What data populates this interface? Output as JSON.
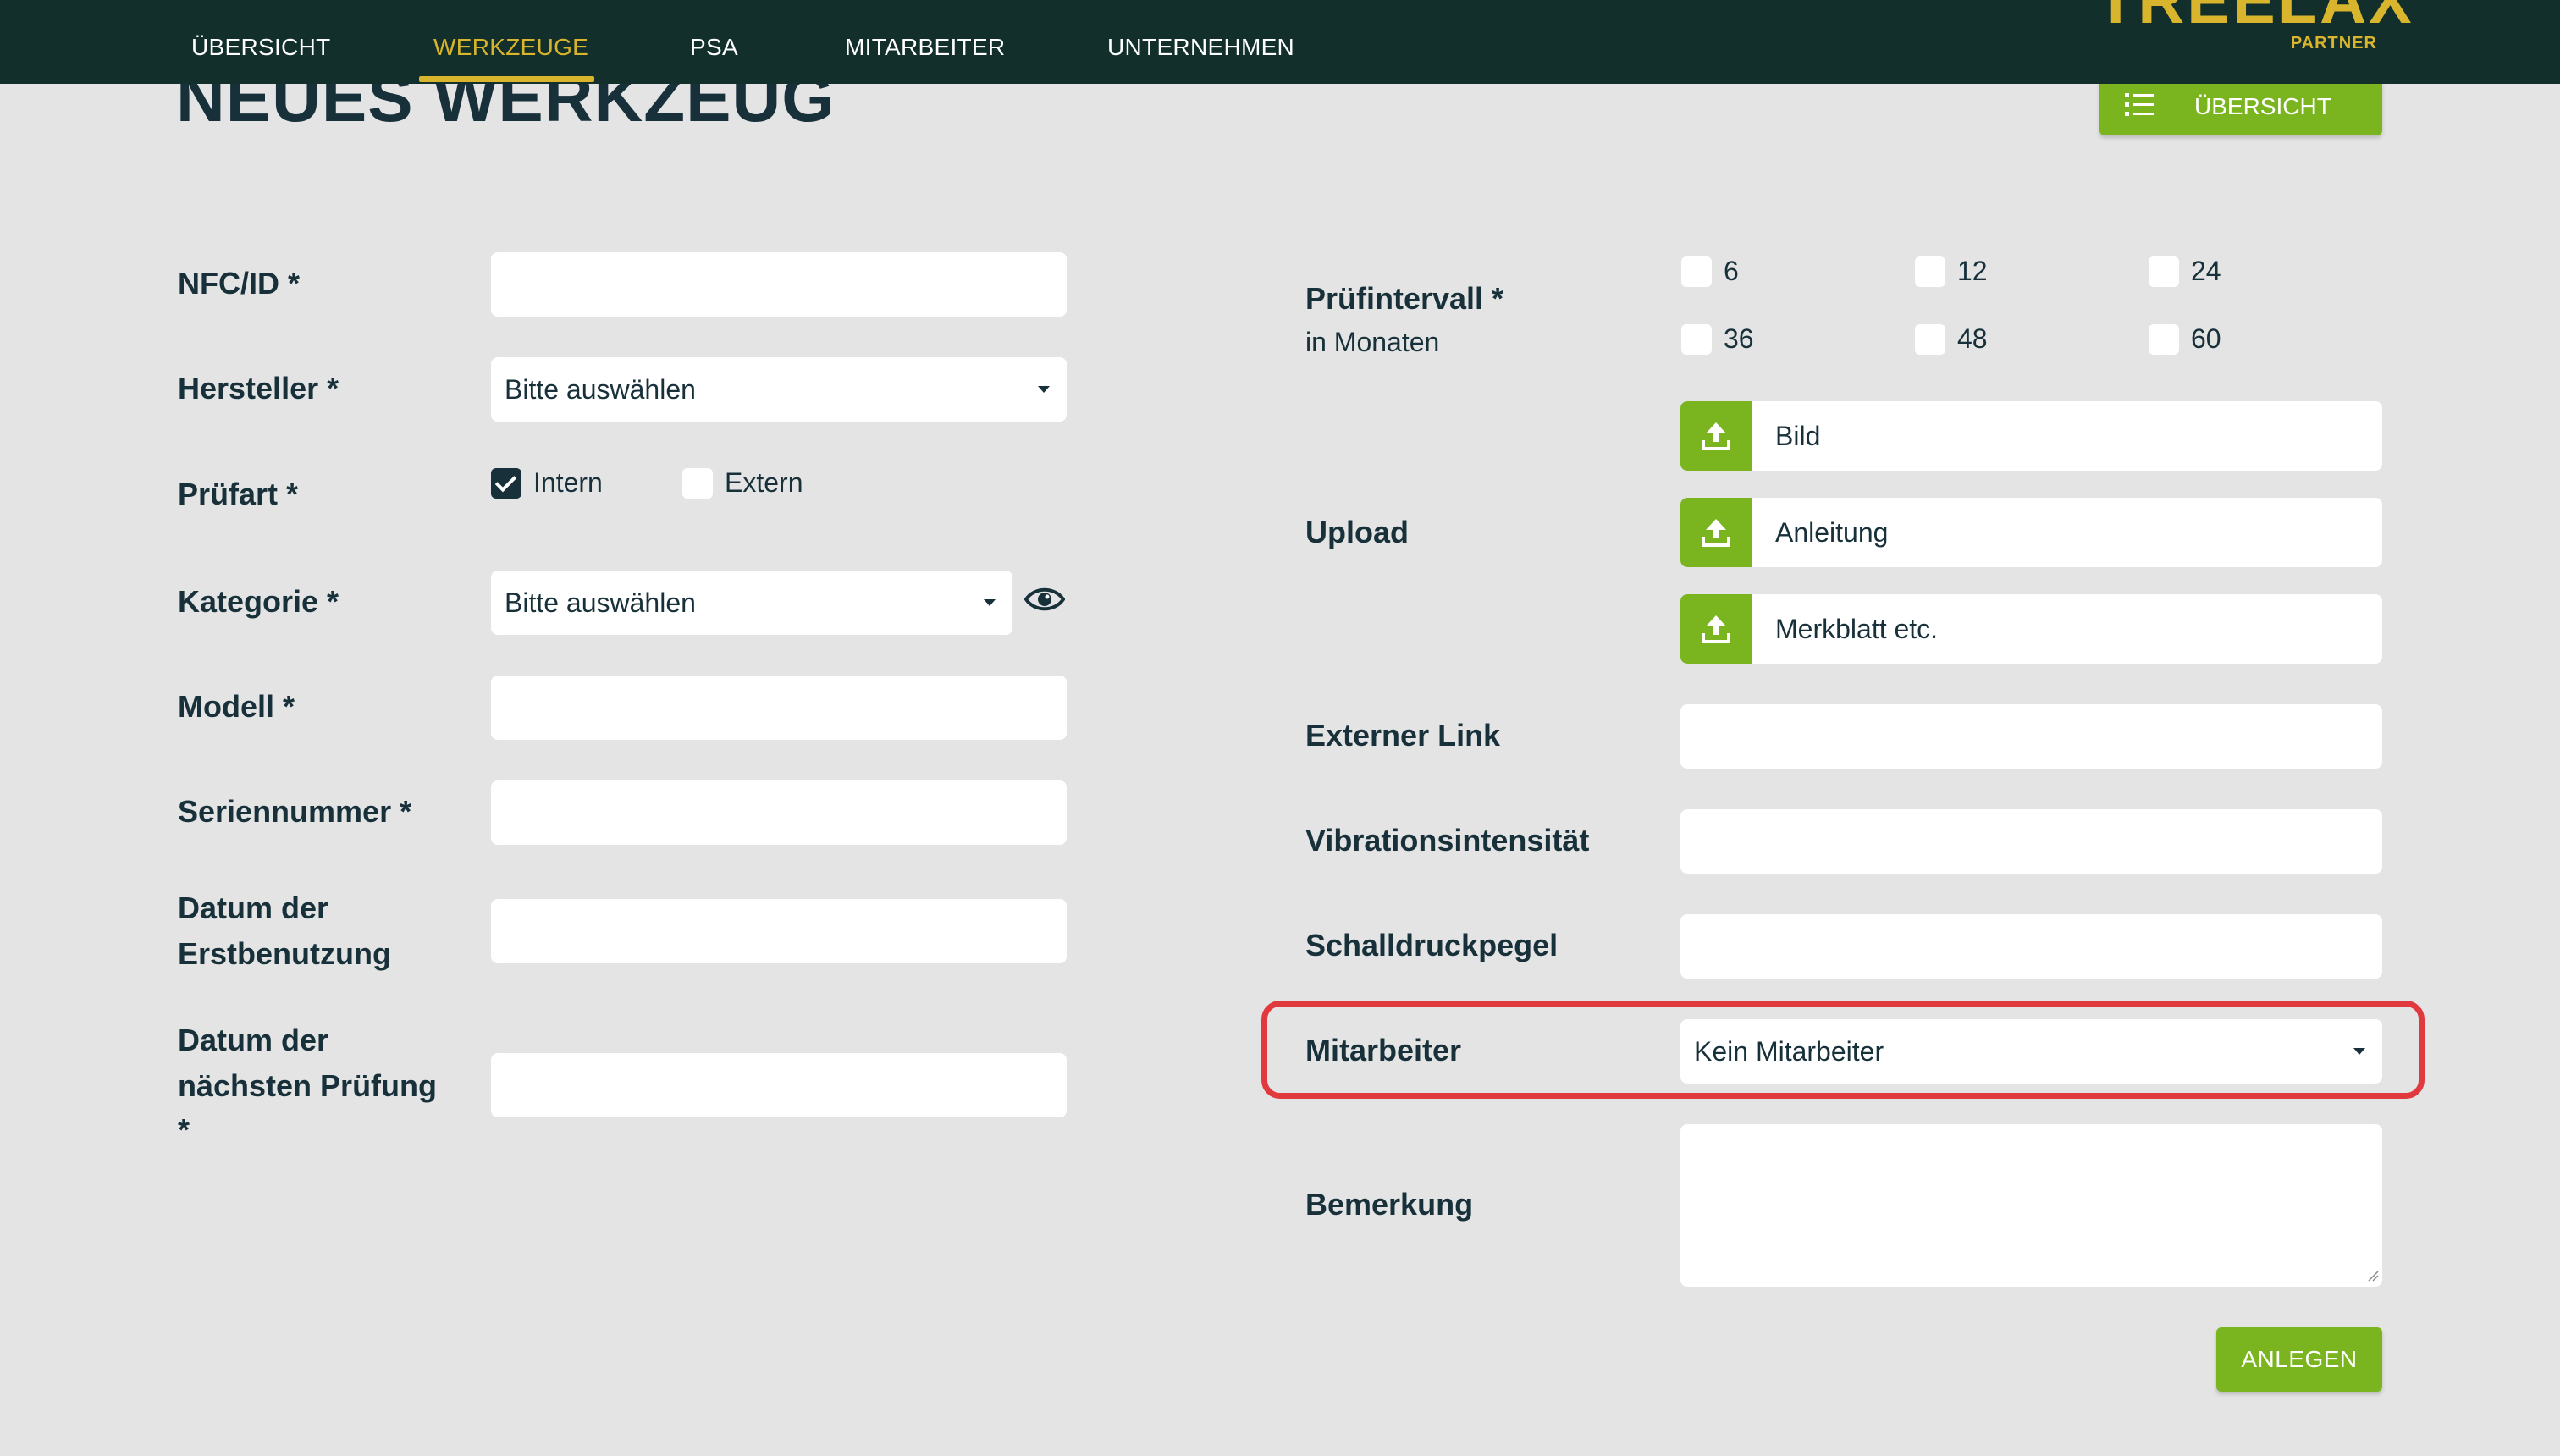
{
  "nav": {
    "items": [
      {
        "label": "ÜBERSICHT",
        "active": false
      },
      {
        "label": "WERKZEUGE",
        "active": true
      },
      {
        "label": "PSA",
        "active": false
      },
      {
        "label": "MITARBEITER",
        "active": false
      },
      {
        "label": "UNTERNEHMEN",
        "active": false
      }
    ],
    "logo": "TREELAX",
    "logo_sub": "PARTNER"
  },
  "page": {
    "title": "NEUES WERKZEUG",
    "overview_button": "ÜBERSICHT"
  },
  "form_left": {
    "nfc_label": "NFC/ID *",
    "nfc_value": "",
    "manufacturer_label": "Hersteller *",
    "manufacturer_value": "Bitte auswählen",
    "test_type_label": "Prüfart *",
    "test_type_options": [
      {
        "label": "Intern",
        "checked": true
      },
      {
        "label": "Extern",
        "checked": false
      }
    ],
    "category_label": "Kategorie *",
    "category_value": "Bitte auswählen",
    "model_label": "Modell *",
    "model_value": "",
    "serial_label": "Seriennummer *",
    "serial_value": "",
    "first_use_label_1": "Datum der",
    "first_use_label_2": "Erstbenutzung",
    "first_use_value": "",
    "next_test_label_1": "Datum der",
    "next_test_label_2": "nächsten Prüfung",
    "next_test_label_3": "*",
    "next_test_value": ""
  },
  "form_right": {
    "interval_label": "Prüfintervall *",
    "interval_sublabel": "in Monaten",
    "interval_options": [
      {
        "label": "6",
        "checked": false
      },
      {
        "label": "12",
        "checked": false
      },
      {
        "label": "24",
        "checked": false
      },
      {
        "label": "36",
        "checked": false
      },
      {
        "label": "48",
        "checked": false
      },
      {
        "label": "60",
        "checked": false
      }
    ],
    "upload_label": "Upload",
    "uploads": [
      {
        "label": "Bild"
      },
      {
        "label": "Anleitung"
      },
      {
        "label": "Merkblatt etc."
      }
    ],
    "external_link_label": "Externer Link",
    "external_link_value": "",
    "vibration_label": "Vibrationsintensität",
    "vibration_value": "",
    "sound_label": "Schalldruckpegel",
    "sound_value": "",
    "employee_label": "Mitarbeiter",
    "employee_value": "Kein Mitarbeiter",
    "remark_label": "Bemerkung",
    "remark_value": "",
    "create_button": "ANLEGEN"
  },
  "colors": {
    "nav_bg": "#122f2b",
    "accent_gold": "#d8b52c",
    "accent_green": "#7ab520",
    "text_dark": "#17303a",
    "page_bg": "#e4e4e4",
    "highlight_red": "#e0393e"
  },
  "icons": {
    "overview_button_icon": "list-icon",
    "upload_icon": "upload-icon",
    "category_icon": "eye-icon"
  }
}
